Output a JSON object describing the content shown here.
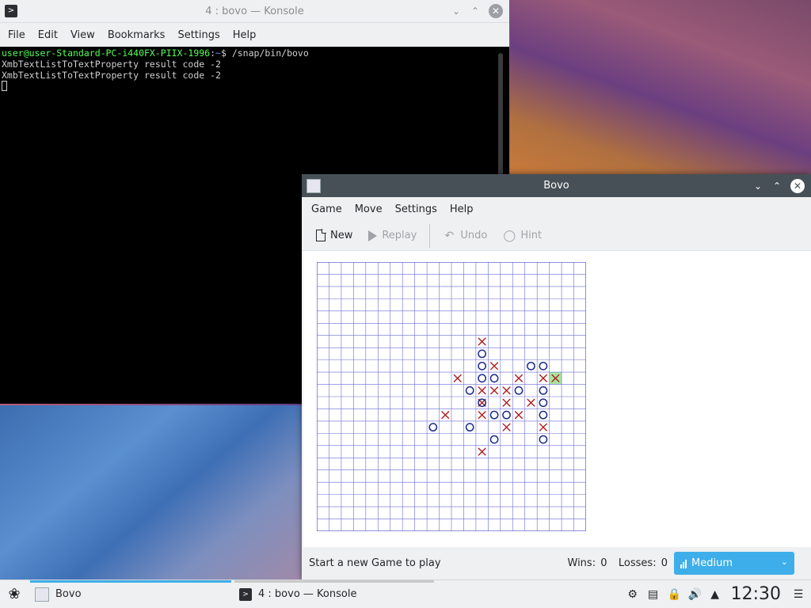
{
  "konsole": {
    "title": "4 : bovo — Konsole",
    "menu": [
      "File",
      "Edit",
      "View",
      "Bookmarks",
      "Settings",
      "Help"
    ],
    "prompt_user": "user@user-Standard-PC-i440FX-PIIX-1996",
    "prompt_sep": ":",
    "prompt_path": "~",
    "prompt_cmd": "$ /snap/bin/bovo",
    "output": [
      "XmbTextListToTextProperty result code -2",
      "XmbTextListToTextProperty result code -2"
    ]
  },
  "bovo": {
    "title": "Bovo",
    "menu": [
      "Game",
      "Move",
      "Settings",
      "Help"
    ],
    "toolbar": {
      "new": "New",
      "replay": "Replay",
      "undo": "Undo",
      "hint": "Hint"
    },
    "status": "Start a new Game to play",
    "wins_label": "Wins:",
    "wins": "0",
    "losses_label": "Losses:",
    "losses": "0",
    "difficulty": "Medium",
    "board": {
      "size": 22,
      "x_color": "#b01c1c",
      "o_color": "#1a2a8a",
      "grid_color": "#6a6ad8",
      "highlight_color": "#a8e6a0",
      "last_move": [
        19,
        9
      ],
      "x": [
        [
          13,
          6
        ],
        [
          14,
          8
        ],
        [
          11,
          9
        ],
        [
          16,
          9
        ],
        [
          18,
          9
        ],
        [
          13,
          10
        ],
        [
          14,
          10
        ],
        [
          15,
          10
        ],
        [
          13,
          11
        ],
        [
          15,
          11
        ],
        [
          17,
          11
        ],
        [
          10,
          12
        ],
        [
          13,
          12
        ],
        [
          16,
          12
        ],
        [
          15,
          13
        ],
        [
          18,
          13
        ],
        [
          13,
          15
        ],
        [
          19,
          9
        ]
      ],
      "o": [
        [
          13,
          7
        ],
        [
          13,
          8
        ],
        [
          17,
          8
        ],
        [
          18,
          8
        ],
        [
          13,
          9
        ],
        [
          14,
          9
        ],
        [
          12,
          10
        ],
        [
          16,
          10
        ],
        [
          18,
          10
        ],
        [
          13,
          11
        ],
        [
          18,
          11
        ],
        [
          14,
          12
        ],
        [
          15,
          12
        ],
        [
          18,
          12
        ],
        [
          9,
          13
        ],
        [
          12,
          13
        ],
        [
          14,
          14
        ],
        [
          18,
          14
        ]
      ]
    }
  },
  "taskbar": {
    "tasks": [
      {
        "label": "Bovo"
      },
      {
        "label": "4 : bovo — Konsole"
      }
    ],
    "clock": "12:30"
  }
}
